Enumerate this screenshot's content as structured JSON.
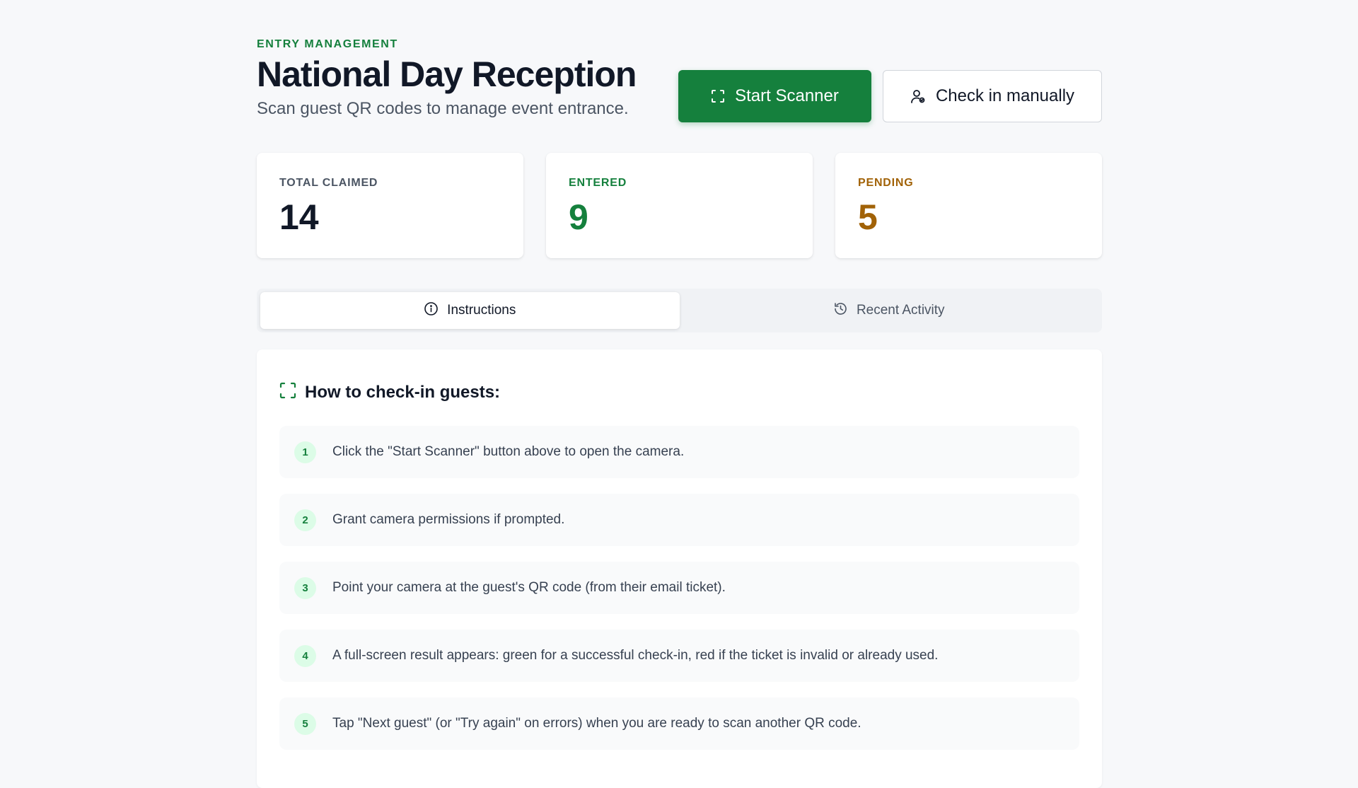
{
  "header": {
    "eyebrow": "ENTRY MANAGEMENT",
    "title": "National Day Reception",
    "subtitle": "Scan guest QR codes to manage event entrance.",
    "start_scanner_label": "Start Scanner",
    "check_in_manually_label": "Check in manually"
  },
  "stats": [
    {
      "label": "TOTAL CLAIMED",
      "value": "14",
      "color": "#111827"
    },
    {
      "label": "ENTERED",
      "value": "9",
      "color": "#15803d"
    },
    {
      "label": "PENDING",
      "value": "5",
      "color": "#a16207"
    }
  ],
  "tabs": [
    {
      "label": "Instructions",
      "icon": "info-icon",
      "active": true
    },
    {
      "label": "Recent Activity",
      "icon": "history-icon",
      "active": false
    }
  ],
  "instructions": {
    "heading": "How to check-in guests:",
    "heading_icon": "scan-icon",
    "steps": [
      {
        "num": "1",
        "text": "Click the \"Start Scanner\" button above to open the camera."
      },
      {
        "num": "2",
        "text": "Grant camera permissions if prompted."
      },
      {
        "num": "3",
        "text": "Point your camera at the guest's QR code (from their email ticket)."
      },
      {
        "num": "4",
        "text": "A full-screen result appears: green for a successful check-in, red if the ticket is invalid or already used."
      },
      {
        "num": "5",
        "text": "Tap \"Next guest\" (or \"Try again\" on errors) when you are ready to scan another QR code."
      }
    ]
  },
  "colors": {
    "accent": "#15803d",
    "pending": "#a16207",
    "background": "#f7f8fa"
  }
}
